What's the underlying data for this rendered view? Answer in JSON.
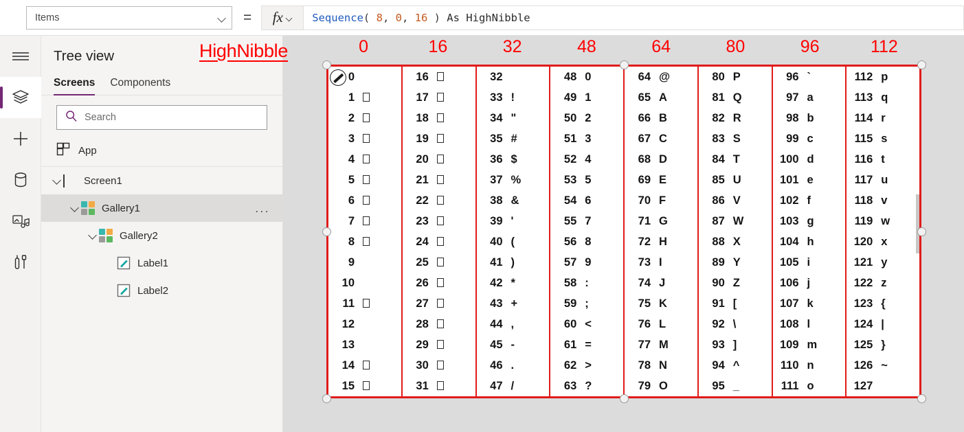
{
  "topbar": {
    "property_selector": {
      "value": "Items",
      "icon": "chevron-down-icon"
    },
    "equals_sign": "=",
    "fx_label": "fx",
    "formula": {
      "full_text": "Sequence( 8, 0, 16 ) As HighNibble",
      "tokens": [
        {
          "text": "Sequence",
          "kind": "function"
        },
        {
          "text": "( ",
          "kind": "punct"
        },
        {
          "text": "8",
          "kind": "number"
        },
        {
          "text": ", ",
          "kind": "punct"
        },
        {
          "text": "0",
          "kind": "number"
        },
        {
          "text": ", ",
          "kind": "punct"
        },
        {
          "text": "16",
          "kind": "number"
        },
        {
          "text": " ) ",
          "kind": "punct"
        },
        {
          "text": "As HighNibble",
          "kind": "text"
        }
      ]
    }
  },
  "rail": {
    "items": [
      {
        "name": "hamburger-menu-icon",
        "label": "Menu",
        "active": false
      },
      {
        "name": "tree-view-icon",
        "label": "Tree view",
        "active": true
      },
      {
        "name": "insert-icon",
        "label": "Insert",
        "active": false
      },
      {
        "name": "data-icon",
        "label": "Data",
        "active": false
      },
      {
        "name": "media-icon",
        "label": "Media",
        "active": false
      },
      {
        "name": "advanced-tools-icon",
        "label": "Advanced tools",
        "active": false
      }
    ]
  },
  "treeview": {
    "title": "Tree view",
    "tabs": [
      {
        "label": "Screens",
        "selected": true
      },
      {
        "label": "Components",
        "selected": false
      }
    ],
    "search": {
      "placeholder": "Search",
      "value": "",
      "icon": "search-icon"
    },
    "app_node": {
      "label": "App",
      "icon": "app-icon"
    },
    "nodes": [
      {
        "label": "Screen1",
        "icon": "screen-icon",
        "indent": 0,
        "expanded": true,
        "selected": false,
        "has_menu": false
      },
      {
        "label": "Gallery1",
        "icon": "gallery-icon",
        "indent": 1,
        "expanded": true,
        "selected": true,
        "has_menu": true,
        "menu": "..."
      },
      {
        "label": "Gallery2",
        "icon": "gallery-icon",
        "indent": 2,
        "expanded": true,
        "selected": false,
        "has_menu": false
      },
      {
        "label": "Label1",
        "icon": "label-icon",
        "indent": 3,
        "expanded": false,
        "selected": false,
        "has_menu": false
      },
      {
        "label": "Label2",
        "icon": "label-icon",
        "indent": 3,
        "expanded": false,
        "selected": false,
        "has_menu": false
      }
    ]
  },
  "canvas": {
    "annotation_label": "HighNibble",
    "annotation_color": "#ff0000",
    "selection_color": "#e01b1b",
    "column_headers": [
      "0",
      "16",
      "32",
      "48",
      "64",
      "80",
      "96",
      "112"
    ],
    "columns": [
      {
        "header": "0",
        "rows": [
          {
            "num": "0",
            "ch": "",
            "tofu": false,
            "selected": true
          },
          {
            "num": "1",
            "ch": "",
            "tofu": true
          },
          {
            "num": "2",
            "ch": "",
            "tofu": true
          },
          {
            "num": "3",
            "ch": "",
            "tofu": true
          },
          {
            "num": "4",
            "ch": "",
            "tofu": true
          },
          {
            "num": "5",
            "ch": "",
            "tofu": true
          },
          {
            "num": "6",
            "ch": "",
            "tofu": true
          },
          {
            "num": "7",
            "ch": "",
            "tofu": true
          },
          {
            "num": "8",
            "ch": "",
            "tofu": true
          },
          {
            "num": "9",
            "ch": "",
            "tofu": false
          },
          {
            "num": "10",
            "ch": "",
            "tofu": false
          },
          {
            "num": "11",
            "ch": "",
            "tofu": true
          },
          {
            "num": "12",
            "ch": "",
            "tofu": false
          },
          {
            "num": "13",
            "ch": "",
            "tofu": false
          },
          {
            "num": "14",
            "ch": "",
            "tofu": true
          },
          {
            "num": "15",
            "ch": "",
            "tofu": true
          }
        ]
      },
      {
        "header": "16",
        "rows": [
          {
            "num": "16",
            "ch": "",
            "tofu": true
          },
          {
            "num": "17",
            "ch": "",
            "tofu": true
          },
          {
            "num": "18",
            "ch": "",
            "tofu": true
          },
          {
            "num": "19",
            "ch": "",
            "tofu": true
          },
          {
            "num": "20",
            "ch": "",
            "tofu": true
          },
          {
            "num": "21",
            "ch": "",
            "tofu": true
          },
          {
            "num": "22",
            "ch": "",
            "tofu": true
          },
          {
            "num": "23",
            "ch": "",
            "tofu": true
          },
          {
            "num": "24",
            "ch": "",
            "tofu": true
          },
          {
            "num": "25",
            "ch": "",
            "tofu": true
          },
          {
            "num": "26",
            "ch": "",
            "tofu": true
          },
          {
            "num": "27",
            "ch": "",
            "tofu": true
          },
          {
            "num": "28",
            "ch": "",
            "tofu": true
          },
          {
            "num": "29",
            "ch": "",
            "tofu": true
          },
          {
            "num": "30",
            "ch": "",
            "tofu": true
          },
          {
            "num": "31",
            "ch": "",
            "tofu": true
          }
        ]
      },
      {
        "header": "32",
        "rows": [
          {
            "num": "32",
            "ch": "",
            "tofu": false
          },
          {
            "num": "33",
            "ch": "!",
            "tofu": false
          },
          {
            "num": "34",
            "ch": "\"",
            "tofu": false
          },
          {
            "num": "35",
            "ch": "#",
            "tofu": false
          },
          {
            "num": "36",
            "ch": "$",
            "tofu": false
          },
          {
            "num": "37",
            "ch": "%",
            "tofu": false
          },
          {
            "num": "38",
            "ch": "&",
            "tofu": false
          },
          {
            "num": "39",
            "ch": "'",
            "tofu": false
          },
          {
            "num": "40",
            "ch": "(",
            "tofu": false
          },
          {
            "num": "41",
            "ch": ")",
            "tofu": false
          },
          {
            "num": "42",
            "ch": "*",
            "tofu": false
          },
          {
            "num": "43",
            "ch": "+",
            "tofu": false
          },
          {
            "num": "44",
            "ch": ",",
            "tofu": false
          },
          {
            "num": "45",
            "ch": "-",
            "tofu": false
          },
          {
            "num": "46",
            "ch": ".",
            "tofu": false
          },
          {
            "num": "47",
            "ch": "/",
            "tofu": false
          }
        ]
      },
      {
        "header": "48",
        "rows": [
          {
            "num": "48",
            "ch": "0",
            "tofu": false
          },
          {
            "num": "49",
            "ch": "1",
            "tofu": false
          },
          {
            "num": "50",
            "ch": "2",
            "tofu": false
          },
          {
            "num": "51",
            "ch": "3",
            "tofu": false
          },
          {
            "num": "52",
            "ch": "4",
            "tofu": false
          },
          {
            "num": "53",
            "ch": "5",
            "tofu": false
          },
          {
            "num": "54",
            "ch": "6",
            "tofu": false
          },
          {
            "num": "55",
            "ch": "7",
            "tofu": false
          },
          {
            "num": "56",
            "ch": "8",
            "tofu": false
          },
          {
            "num": "57",
            "ch": "9",
            "tofu": false
          },
          {
            "num": "58",
            "ch": ":",
            "tofu": false
          },
          {
            "num": "59",
            "ch": ";",
            "tofu": false
          },
          {
            "num": "60",
            "ch": "<",
            "tofu": false
          },
          {
            "num": "61",
            "ch": "=",
            "tofu": false
          },
          {
            "num": "62",
            "ch": ">",
            "tofu": false
          },
          {
            "num": "63",
            "ch": "?",
            "tofu": false
          }
        ]
      },
      {
        "header": "64",
        "rows": [
          {
            "num": "64",
            "ch": "@",
            "tofu": false
          },
          {
            "num": "65",
            "ch": "A",
            "tofu": false
          },
          {
            "num": "66",
            "ch": "B",
            "tofu": false
          },
          {
            "num": "67",
            "ch": "C",
            "tofu": false
          },
          {
            "num": "68",
            "ch": "D",
            "tofu": false
          },
          {
            "num": "69",
            "ch": "E",
            "tofu": false
          },
          {
            "num": "70",
            "ch": "F",
            "tofu": false
          },
          {
            "num": "71",
            "ch": "G",
            "tofu": false
          },
          {
            "num": "72",
            "ch": "H",
            "tofu": false
          },
          {
            "num": "73",
            "ch": "I",
            "tofu": false
          },
          {
            "num": "74",
            "ch": "J",
            "tofu": false
          },
          {
            "num": "75",
            "ch": "K",
            "tofu": false
          },
          {
            "num": "76",
            "ch": "L",
            "tofu": false
          },
          {
            "num": "77",
            "ch": "M",
            "tofu": false
          },
          {
            "num": "78",
            "ch": "N",
            "tofu": false
          },
          {
            "num": "79",
            "ch": "O",
            "tofu": false
          }
        ]
      },
      {
        "header": "80",
        "rows": [
          {
            "num": "80",
            "ch": "P",
            "tofu": false
          },
          {
            "num": "81",
            "ch": "Q",
            "tofu": false
          },
          {
            "num": "82",
            "ch": "R",
            "tofu": false
          },
          {
            "num": "83",
            "ch": "S",
            "tofu": false
          },
          {
            "num": "84",
            "ch": "T",
            "tofu": false
          },
          {
            "num": "85",
            "ch": "U",
            "tofu": false
          },
          {
            "num": "86",
            "ch": "V",
            "tofu": false
          },
          {
            "num": "87",
            "ch": "W",
            "tofu": false
          },
          {
            "num": "88",
            "ch": "X",
            "tofu": false
          },
          {
            "num": "89",
            "ch": "Y",
            "tofu": false
          },
          {
            "num": "90",
            "ch": "Z",
            "tofu": false
          },
          {
            "num": "91",
            "ch": "[",
            "tofu": false
          },
          {
            "num": "92",
            "ch": "\\",
            "tofu": false
          },
          {
            "num": "93",
            "ch": "]",
            "tofu": false
          },
          {
            "num": "94",
            "ch": "^",
            "tofu": false
          },
          {
            "num": "95",
            "ch": "_",
            "tofu": false
          }
        ]
      },
      {
        "header": "96",
        "rows": [
          {
            "num": "96",
            "ch": "`",
            "tofu": false
          },
          {
            "num": "97",
            "ch": "a",
            "tofu": false
          },
          {
            "num": "98",
            "ch": "b",
            "tofu": false
          },
          {
            "num": "99",
            "ch": "c",
            "tofu": false
          },
          {
            "num": "100",
            "ch": "d",
            "tofu": false
          },
          {
            "num": "101",
            "ch": "e",
            "tofu": false
          },
          {
            "num": "102",
            "ch": "f",
            "tofu": false
          },
          {
            "num": "103",
            "ch": "g",
            "tofu": false
          },
          {
            "num": "104",
            "ch": "h",
            "tofu": false
          },
          {
            "num": "105",
            "ch": "i",
            "tofu": false
          },
          {
            "num": "106",
            "ch": "j",
            "tofu": false
          },
          {
            "num": "107",
            "ch": "k",
            "tofu": false
          },
          {
            "num": "108",
            "ch": "l",
            "tofu": false
          },
          {
            "num": "109",
            "ch": "m",
            "tofu": false
          },
          {
            "num": "110",
            "ch": "n",
            "tofu": false
          },
          {
            "num": "111",
            "ch": "o",
            "tofu": false
          }
        ]
      },
      {
        "header": "112",
        "rows": [
          {
            "num": "112",
            "ch": "p",
            "tofu": false
          },
          {
            "num": "113",
            "ch": "q",
            "tofu": false
          },
          {
            "num": "114",
            "ch": "r",
            "tofu": false
          },
          {
            "num": "115",
            "ch": "s",
            "tofu": false
          },
          {
            "num": "116",
            "ch": "t",
            "tofu": false
          },
          {
            "num": "117",
            "ch": "u",
            "tofu": false
          },
          {
            "num": "118",
            "ch": "v",
            "tofu": false
          },
          {
            "num": "119",
            "ch": "w",
            "tofu": false
          },
          {
            "num": "120",
            "ch": "x",
            "tofu": false
          },
          {
            "num": "121",
            "ch": "y",
            "tofu": false
          },
          {
            "num": "122",
            "ch": "z",
            "tofu": false
          },
          {
            "num": "123",
            "ch": "{",
            "tofu": false
          },
          {
            "num": "124",
            "ch": "|",
            "tofu": false
          },
          {
            "num": "125",
            "ch": "}",
            "tofu": false
          },
          {
            "num": "126",
            "ch": "~",
            "tofu": false
          },
          {
            "num": "127",
            "ch": "",
            "tofu": false
          }
        ]
      }
    ]
  }
}
